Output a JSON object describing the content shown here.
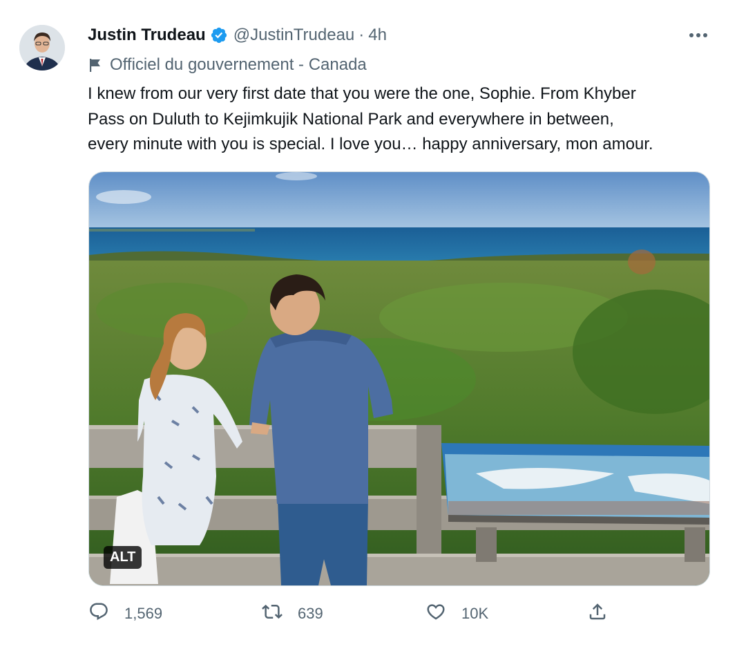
{
  "author": {
    "display_name": "Justin Trudeau",
    "handle": "@JustinTrudeau",
    "separator": "·",
    "time": "4h",
    "label": "Officiel du gouvernement - Canada"
  },
  "tweet": {
    "lines": [
      "I knew from our very first date that you were the one, Sophie. From Khyber",
      "Pass on Duluth to Kejimkujik National Park and everywhere in between,",
      "every minute with you is special. I love you… happy anniversary, mon amour."
    ]
  },
  "media": {
    "alt_label": "ALT"
  },
  "actions": {
    "replies": "1,569",
    "retweets": "639",
    "likes": "10K"
  },
  "colors": {
    "verified_blue": "#1d9bf0",
    "text_primary": "#0f1419",
    "text_secondary": "#536471"
  },
  "icons": [
    "verified-badge-icon",
    "more-icon",
    "flag-icon",
    "reply-icon",
    "retweet-icon",
    "like-icon",
    "share-icon"
  ]
}
